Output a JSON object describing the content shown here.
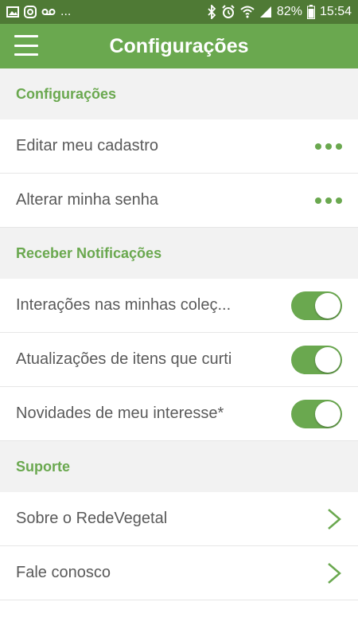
{
  "status_bar": {
    "left_icons": [
      "image-icon",
      "instagram-icon",
      "voicemail-icon"
    ],
    "left_more": "...",
    "right_icons": [
      "bluetooth-icon",
      "alarm-icon",
      "wifi-icon",
      "signal-icon"
    ],
    "battery_percent": "82%",
    "time": "15:54"
  },
  "app_bar": {
    "title": "Configurações",
    "menu_icon": "hamburger-icon"
  },
  "sections": {
    "config": {
      "title": "Configurações"
    },
    "notifications": {
      "title": "Receber Notificações"
    },
    "support": {
      "title": "Suporte"
    }
  },
  "rows": {
    "edit_profile": {
      "label": "Editar meu cadastro"
    },
    "change_password": {
      "label": "Alterar minha senha"
    },
    "interactions": {
      "label": "Interações nas minhas coleç...",
      "enabled": true
    },
    "updates": {
      "label": "Atualizações de itens que curti",
      "enabled": true
    },
    "news": {
      "label": "Novidades de meu interesse*",
      "enabled": true
    },
    "about": {
      "label": "Sobre o RedeVegetal"
    },
    "contact": {
      "label": "Fale conosco"
    }
  },
  "colors": {
    "primary": "#6aa84f",
    "status_bar": "#4f7a35",
    "section_bg": "#f2f2f2",
    "text": "#5a5a5a"
  }
}
